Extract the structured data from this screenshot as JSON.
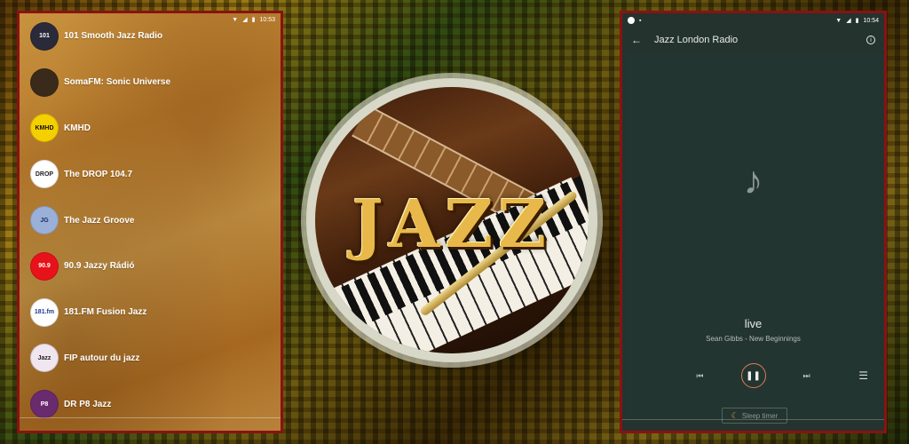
{
  "left_phone": {
    "status": {
      "time": "10:53"
    },
    "stations": [
      {
        "name": "101 Smooth Jazz Radio",
        "logo_text": "101",
        "logo_bg": "#2a2a3a",
        "logo_color": "#ffffff"
      },
      {
        "name": "SomaFM: Sonic Universe",
        "logo_text": "",
        "logo_bg": "#3a2a1a",
        "logo_color": "#ffffff"
      },
      {
        "name": "KMHD",
        "logo_text": "KMHD",
        "logo_bg": "#f5d000",
        "logo_color": "#111111"
      },
      {
        "name": "The DROP 104.7",
        "logo_text": "DROP",
        "logo_bg": "#ffffff",
        "logo_color": "#222222"
      },
      {
        "name": "The Jazz Groove",
        "logo_text": "JG",
        "logo_bg": "#9ab0d8",
        "logo_color": "#1a2a5a"
      },
      {
        "name": "90.9 Jazzy Rádió",
        "logo_text": "90.9",
        "logo_bg": "#e8121a",
        "logo_color": "#ffffff"
      },
      {
        "name": "181.FM Fusion Jazz",
        "logo_text": "181.fm",
        "logo_bg": "#ffffff",
        "logo_color": "#1a3a8a"
      },
      {
        "name": "FIP autour du jazz",
        "logo_text": "Jazz",
        "logo_bg": "#f0e6ef",
        "logo_color": "#222222"
      },
      {
        "name": "DR P8 Jazz",
        "logo_text": "P8",
        "logo_bg": "#6a2a6e",
        "logo_color": "#ffffff"
      }
    ]
  },
  "center_logo": {
    "text": "JAZZ"
  },
  "right_phone": {
    "status": {
      "time": "10:54"
    },
    "toolbar": {
      "title": "Jazz London Radio",
      "back_icon": "arrow-left-icon",
      "info_icon": "info-icon"
    },
    "player": {
      "title": "live",
      "artist": "Sean Gibbs - New Beginnings",
      "sleep_timer_label": "Sleep timer"
    },
    "colors": {
      "accent": "#e07a5a",
      "background": "#24332e"
    }
  }
}
